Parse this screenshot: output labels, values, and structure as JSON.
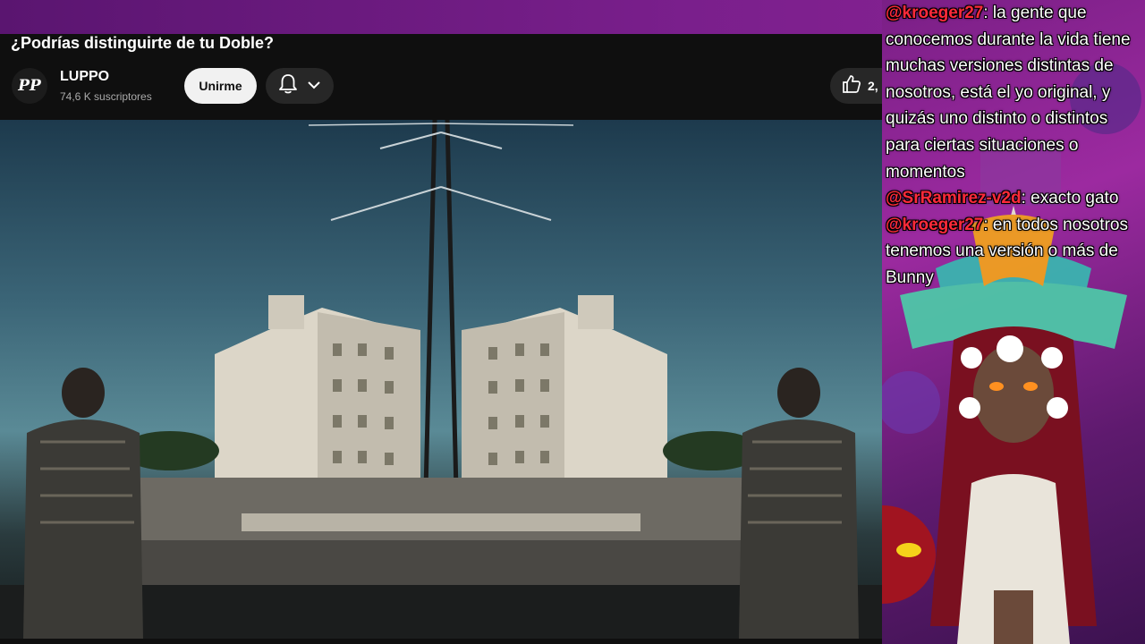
{
  "video": {
    "title": "¿Podrías distinguirte de tu Doble?",
    "channel_avatar_text": "PP",
    "channel_name": "LUPPO",
    "subscribers": "74,6 K suscriptores",
    "join_label": "Unirme",
    "like_count": "2,"
  },
  "chat": [
    {
      "user": "@kroeger27",
      "text": ": la gente que conocemos durante la vida tiene muchas versiones distintas de nosotros, está el yo original, y quizás uno distinto o distintos para ciertas situaciones o momentos"
    },
    {
      "user": "@SrRamirez-v2d",
      "text": ": exacto gato"
    },
    {
      "user": "@kroeger27",
      "text": ": en todos nosotros tenemos una versión o más de Bunny"
    }
  ],
  "colors": {
    "chat_username": "#ff2a3a",
    "overlay_purple": "#7a1f8c",
    "youtube_bg": "#0f0f0f"
  }
}
